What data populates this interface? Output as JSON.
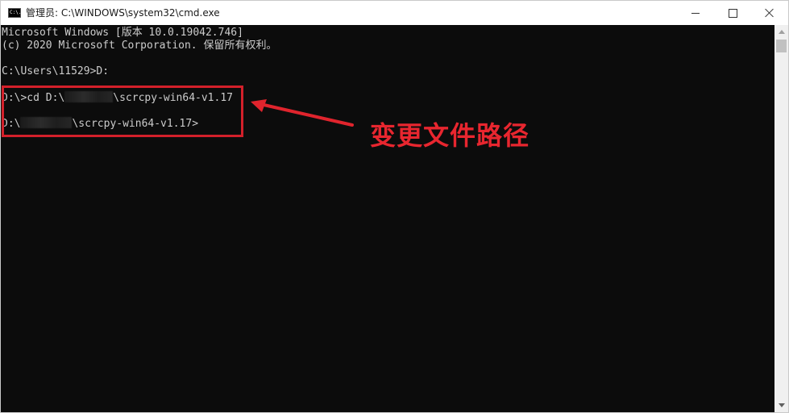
{
  "window": {
    "title": "管理员: C:\\WINDOWS\\system32\\cmd.exe",
    "icon": "cmd-icon",
    "icon_text": "C:\\."
  },
  "controls": {
    "minimize": "minimize-icon",
    "maximize": "maximize-icon",
    "close": "close-icon"
  },
  "console": {
    "line1": "Microsoft Windows [版本 10.0.19042.746]",
    "line2": "(c) 2020 Microsoft Corporation. 保留所有权利。",
    "line3": "C:\\Users\\11529>D:",
    "line4_prefix": "D:\\>cd D:\\",
    "line4_suffix": "\\scrcpy-win64-v1.17",
    "line5_prefix": "D:\\",
    "line5_suffix": "\\scrcpy-win64-v1.17>"
  },
  "annotation": {
    "text": "变更文件路径",
    "color": "#e8262f"
  },
  "colors": {
    "console_bg": "#0c0c0c",
    "console_text": "#cccccc",
    "highlight": "#d3202a"
  }
}
